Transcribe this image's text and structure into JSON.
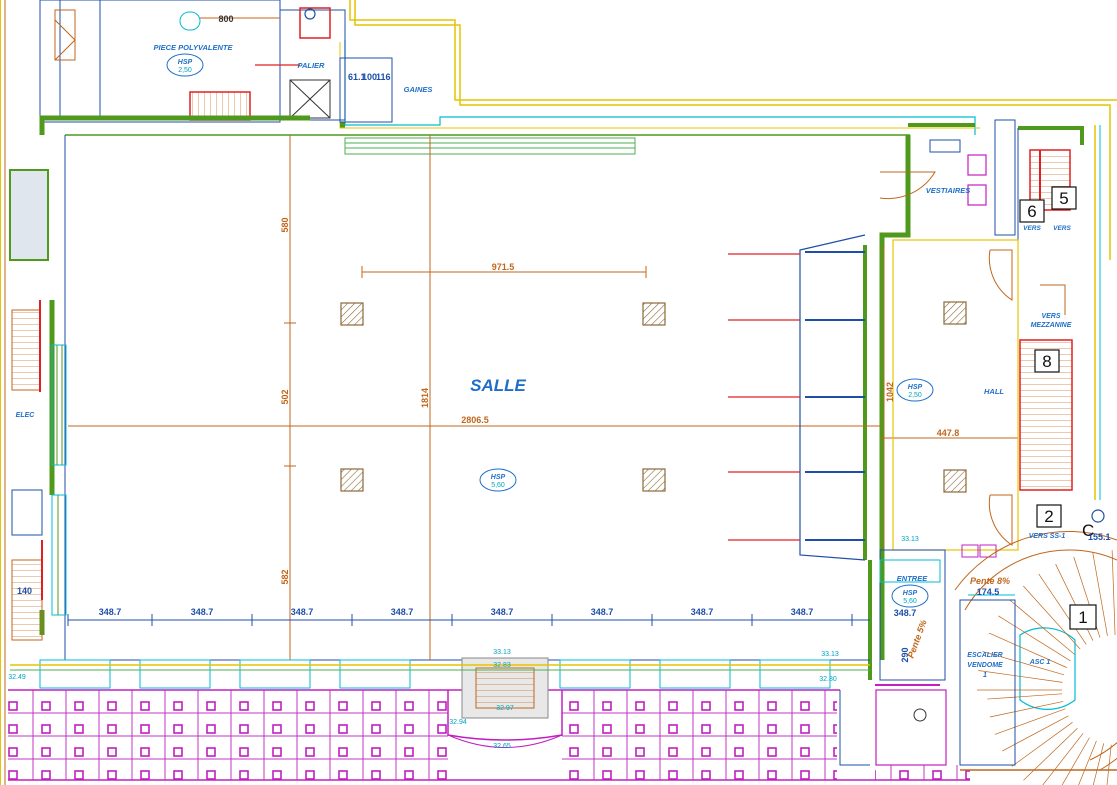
{
  "rooms": {
    "salle": "SALLE",
    "piece_polyvalente": "PIECE POLYVALENTE",
    "palier": "PALIER",
    "gaines": "GAINES",
    "vestiaires": "VESTIAIRES",
    "hall": "HALL",
    "entree": "ENTREE",
    "escalier_line1": "ESCALIER",
    "escalier_line2": "VENDOME",
    "escalier_line3": "1",
    "elec": "ELEC",
    "asc": "ASC 1"
  },
  "directions": {
    "vers_mezzanine_1": "VERS",
    "vers_mezzanine_2": "MEZZANINE",
    "vers_ss1": "VERS SS-1",
    "vers_a": "VERS",
    "vers_b": "VERS"
  },
  "hsp": {
    "label": "HSP",
    "polyvalente": "2,50",
    "salle": "5,60",
    "hall": "2,50",
    "entree": "5,60"
  },
  "dimensions": {
    "top_width": "800",
    "salle_inner_width": "971.5",
    "salle_total_width": "2806.5",
    "salle_depth": "1814",
    "height_upper": "580",
    "height_mid": "502",
    "height_lower": "582",
    "hall_height": "1042",
    "hall_width": "447.8",
    "bay_spacing": [
      "348.7",
      "348.7",
      "348.7",
      "348.7",
      "348.7",
      "348.7",
      "348.7",
      "348.7",
      "348.7"
    ],
    "ramp_width": "174.5",
    "pente_8": "Pente 8%",
    "pente_5": "Pente 5%",
    "entree_width": "290",
    "dim_61": "61.1",
    "dim_100": "100",
    "dim_116": "116",
    "dim_140": "140"
  },
  "levels": {
    "l1": "33.13",
    "l2": "33.13",
    "l3": "33.13",
    "l4": "32.94",
    "l5": "32.97",
    "l6": "32.65",
    "l7": "32.83",
    "l8": "32.80",
    "l9": "32.49"
  },
  "markers": {
    "m1": "1",
    "m2": "2",
    "m5": "5",
    "m6": "6",
    "m8": "8",
    "edge_c": "C",
    "edge_num": "155.1"
  },
  "colors": {
    "wall_green": "#4f9a1d",
    "dim_orange": "#c0661b",
    "text_blue": "#1f6fc8",
    "cyan": "#00bcd4",
    "magenta": "#c020c0",
    "yellow": "#e6c400",
    "red": "#e02020"
  }
}
